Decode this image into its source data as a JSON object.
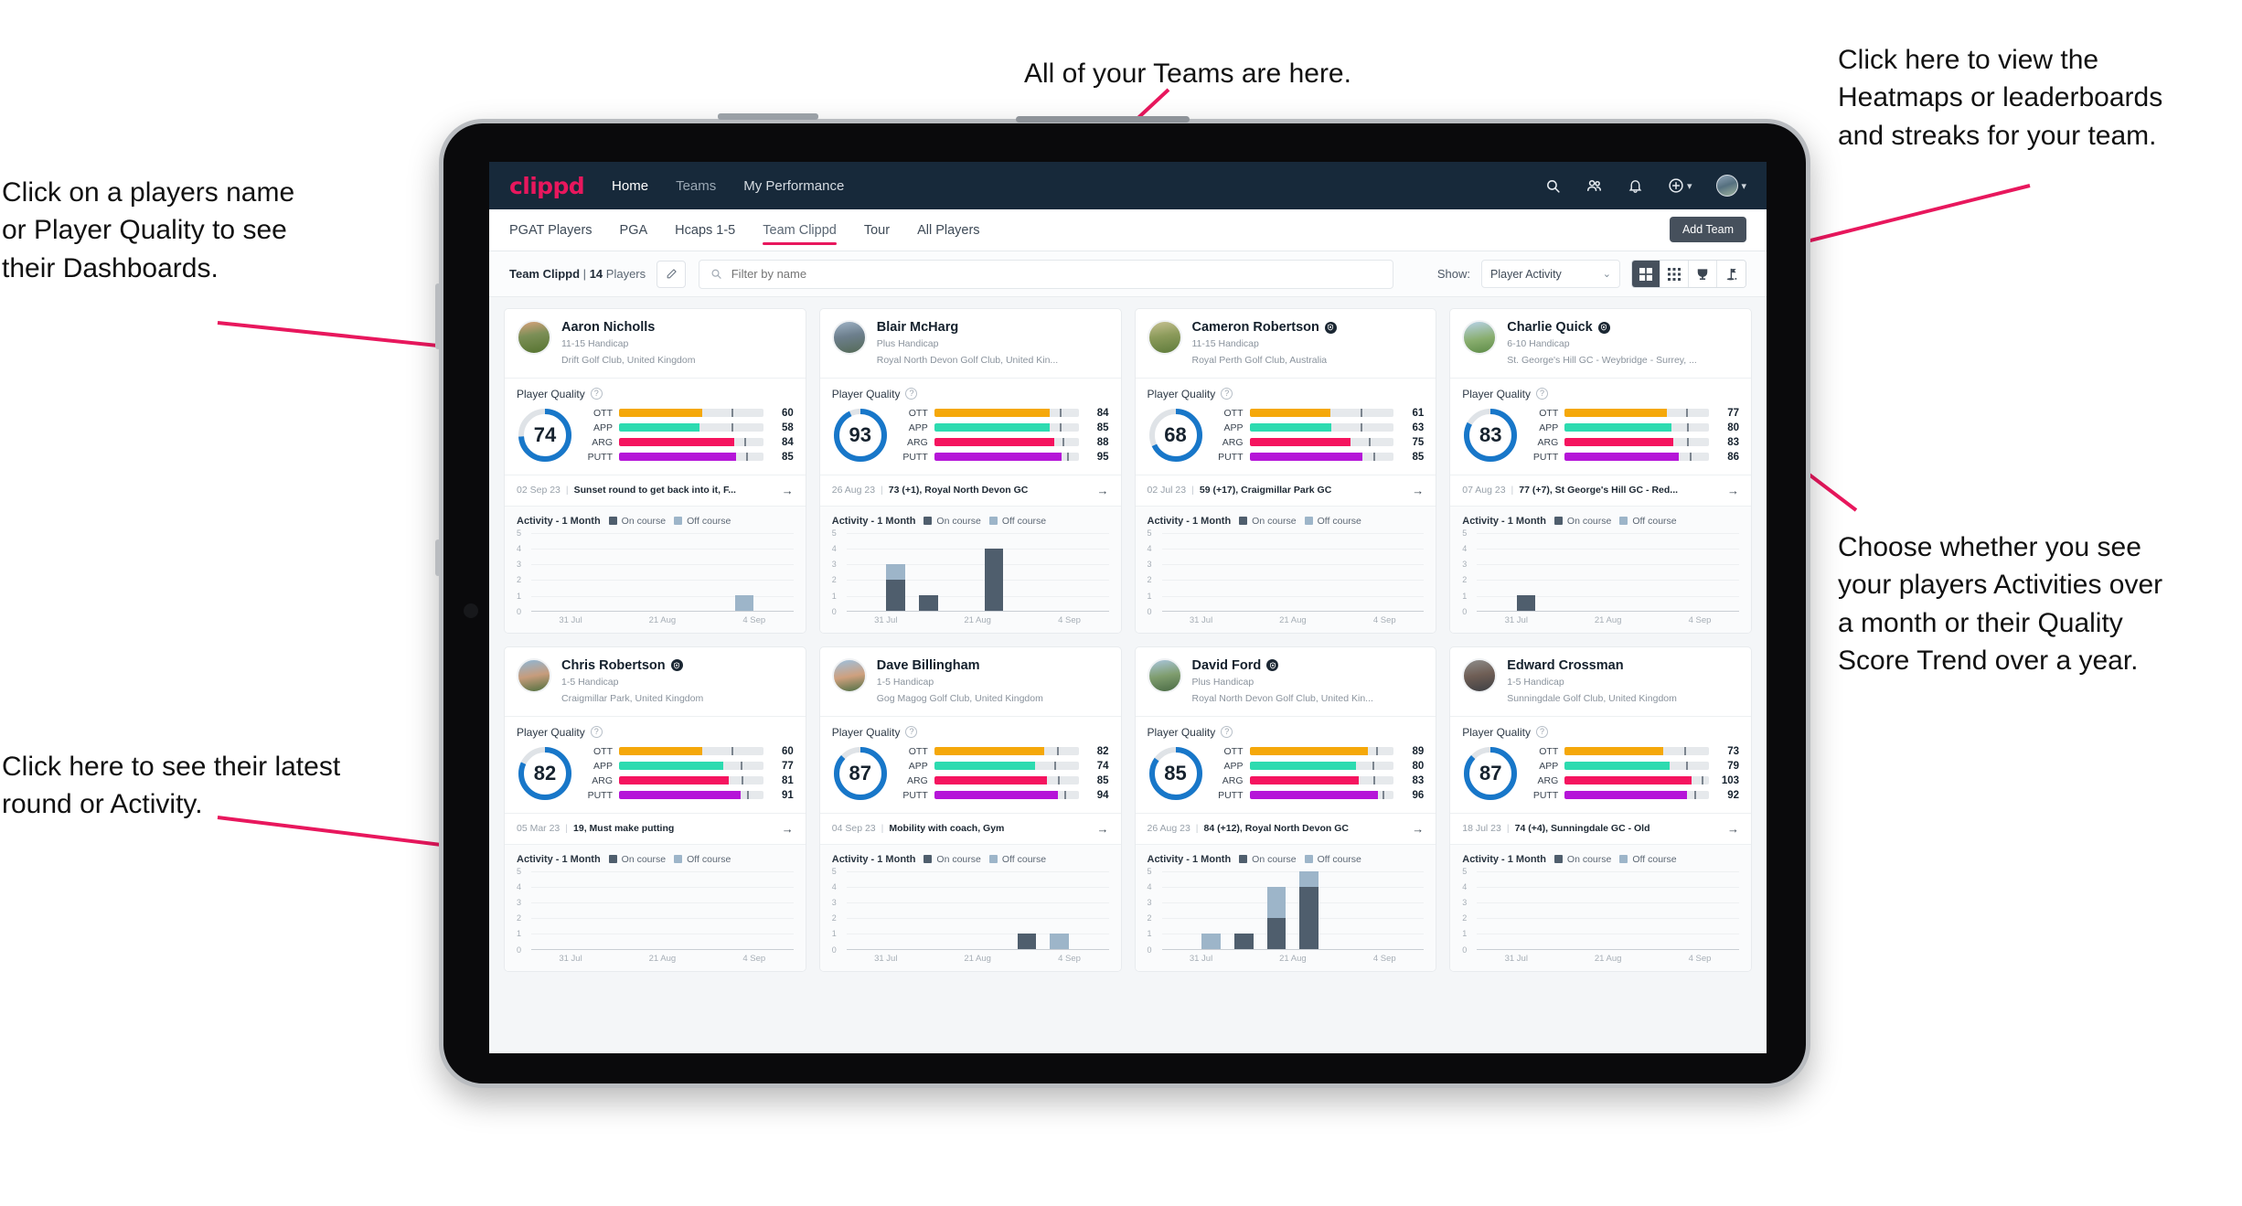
{
  "annotations": {
    "top_left": "Click on a players name\nor Player Quality to see\ntheir Dashboards.",
    "top_center": "All of your Teams are here.",
    "top_right": "Click here to view the\nHeatmaps or leaderboards\nand streaks for your team.",
    "right_bottom": "Choose whether you see\nyour players Activities over\na month or their Quality\nScore Trend over a year.",
    "bottom_left": "Click here to see their latest\nround or Activity.",
    "arrow_color": "#e8175d"
  },
  "app": {
    "logo": "clippd",
    "nav": [
      {
        "label": "Home",
        "active": true
      },
      {
        "label": "Teams",
        "active": false
      },
      {
        "label": "My Performance",
        "active": false
      }
    ],
    "header_icons": [
      {
        "name": "search-icon"
      },
      {
        "name": "people-icon"
      },
      {
        "name": "bell-icon"
      },
      {
        "name": "plus-circle-icon"
      },
      {
        "name": "avatar-icon"
      }
    ]
  },
  "tabs": [
    {
      "label": "PGAT Players",
      "active": false
    },
    {
      "label": "PGA",
      "active": false
    },
    {
      "label": "Hcaps 1-5",
      "active": false
    },
    {
      "label": "Team Clippd",
      "active": true
    },
    {
      "label": "Tour",
      "active": false
    },
    {
      "label": "All Players",
      "active": false
    }
  ],
  "add_team_label": "Add Team",
  "filterbar": {
    "team_name": "Team Clippd",
    "separator": "|",
    "player_count": "14",
    "players_word": "Players",
    "edit_icon": "pencil-icon",
    "search_placeholder": "Filter by name",
    "search_value": "",
    "show_label": "Show:",
    "show_value": "Player Activity",
    "show_options": [
      "Player Activity",
      "Quality Score Trend"
    ],
    "views": [
      {
        "name": "grid-large-view",
        "active": true
      },
      {
        "name": "heatmap-grid-view",
        "active": false
      },
      {
        "name": "trophy-leaderboard-view",
        "active": false
      },
      {
        "name": "golf-flag-streaks-view",
        "active": false
      }
    ]
  },
  "card_labels": {
    "quality_title": "Player Quality",
    "help_glyph": "?",
    "activity_title": "Activity - 1 Month",
    "legend_on": "On course",
    "legend_off": "Off course",
    "arrow_glyph": "→",
    "y_ticks": [
      "5",
      "4",
      "3",
      "2",
      "1",
      "0"
    ],
    "x_ticks": [
      "31 Jul",
      "21 Aug",
      "4 Sep"
    ]
  },
  "skill_colors": {
    "OTT": "#f5a80a",
    "APP": "#2ddbb0",
    "ARG": "#f5145f",
    "PUTT": "#b515d8",
    "donut": "#1877c9",
    "donut_track": "#dfe3e7"
  },
  "players": [
    {
      "name": "Aaron Nicholls",
      "verified": false,
      "handicap": "11-15 Handicap",
      "club": "Drift Golf Club, United Kingdom",
      "quality": 74,
      "skills": [
        {
          "label": "OTT",
          "value": 60,
          "fill": 58,
          "tick": 78
        },
        {
          "label": "APP",
          "value": 58,
          "fill": 56,
          "tick": 78
        },
        {
          "label": "ARG",
          "value": 84,
          "fill": 80,
          "tick": 87
        },
        {
          "label": "PUTT",
          "value": 85,
          "fill": 81,
          "tick": 88
        }
      ],
      "latest_date": "02 Sep 23",
      "latest_text": "Sunset round to get back into it, F...",
      "activity": [
        {
          "on": 0,
          "off": 0
        },
        {
          "on": 0,
          "off": 0
        },
        {
          "on": 0,
          "off": 0
        },
        {
          "on": 0,
          "off": 0
        },
        {
          "on": 0,
          "off": 0
        },
        {
          "on": 0,
          "off": 0
        },
        {
          "on": 0,
          "off": 1
        },
        {
          "on": 0,
          "off": 0
        }
      ]
    },
    {
      "name": "Blair McHarg",
      "verified": false,
      "handicap": "Plus Handicap",
      "club": "Royal North Devon Golf Club, United Kin...",
      "quality": 93,
      "skills": [
        {
          "label": "OTT",
          "value": 84,
          "fill": 80,
          "tick": 87
        },
        {
          "label": "APP",
          "value": 85,
          "fill": 80,
          "tick": 87
        },
        {
          "label": "ARG",
          "value": 88,
          "fill": 83,
          "tick": 89
        },
        {
          "label": "PUTT",
          "value": 95,
          "fill": 88,
          "tick": 92
        }
      ],
      "latest_date": "26 Aug 23",
      "latest_text": "73 (+1), Royal North Devon GC",
      "activity": [
        {
          "on": 0,
          "off": 0
        },
        {
          "on": 2,
          "off": 1
        },
        {
          "on": 1,
          "off": 0
        },
        {
          "on": 0,
          "off": 0
        },
        {
          "on": 4,
          "off": 0
        },
        {
          "on": 0,
          "off": 0
        },
        {
          "on": 0,
          "off": 0
        },
        {
          "on": 0,
          "off": 0
        }
      ]
    },
    {
      "name": "Cameron Robertson",
      "verified": true,
      "handicap": "11-15 Handicap",
      "club": "Royal Perth Golf Club, Australia",
      "quality": 68,
      "skills": [
        {
          "label": "OTT",
          "value": 61,
          "fill": 56,
          "tick": 77
        },
        {
          "label": "APP",
          "value": 63,
          "fill": 57,
          "tick": 77
        },
        {
          "label": "ARG",
          "value": 75,
          "fill": 70,
          "tick": 83
        },
        {
          "label": "PUTT",
          "value": 85,
          "fill": 78,
          "tick": 86
        }
      ],
      "latest_date": "02 Jul 23",
      "latest_text": "59 (+17), Craigmillar Park GC",
      "activity": [
        {
          "on": 0,
          "off": 0
        },
        {
          "on": 0,
          "off": 0
        },
        {
          "on": 0,
          "off": 0
        },
        {
          "on": 0,
          "off": 0
        },
        {
          "on": 0,
          "off": 0
        },
        {
          "on": 0,
          "off": 0
        },
        {
          "on": 0,
          "off": 0
        },
        {
          "on": 0,
          "off": 0
        }
      ]
    },
    {
      "name": "Charlie Quick",
      "verified": true,
      "handicap": "6-10 Handicap",
      "club": "St. George's Hill GC - Weybridge - Surrey, ...",
      "quality": 83,
      "skills": [
        {
          "label": "OTT",
          "value": 77,
          "fill": 71,
          "tick": 84
        },
        {
          "label": "APP",
          "value": 80,
          "fill": 74,
          "tick": 85
        },
        {
          "label": "ARG",
          "value": 83,
          "fill": 75,
          "tick": 85
        },
        {
          "label": "PUTT",
          "value": 86,
          "fill": 79,
          "tick": 87
        }
      ],
      "latest_date": "07 Aug 23",
      "latest_text": "77 (+7), St George's Hill GC - Red...",
      "activity": [
        {
          "on": 0,
          "off": 0
        },
        {
          "on": 1,
          "off": 0
        },
        {
          "on": 0,
          "off": 0
        },
        {
          "on": 0,
          "off": 0
        },
        {
          "on": 0,
          "off": 0
        },
        {
          "on": 0,
          "off": 0
        },
        {
          "on": 0,
          "off": 0
        },
        {
          "on": 0,
          "off": 0
        }
      ]
    },
    {
      "name": "Chris Robertson",
      "verified": true,
      "handicap": "1-5 Handicap",
      "club": "Craigmillar Park, United Kingdom",
      "quality": 82,
      "skills": [
        {
          "label": "OTT",
          "value": 60,
          "fill": 58,
          "tick": 78
        },
        {
          "label": "APP",
          "value": 77,
          "fill": 72,
          "tick": 84
        },
        {
          "label": "ARG",
          "value": 81,
          "fill": 76,
          "tick": 85
        },
        {
          "label": "PUTT",
          "value": 91,
          "fill": 84,
          "tick": 89
        }
      ],
      "latest_date": "05 Mar 23",
      "latest_text": "19, Must make putting",
      "activity": [
        {
          "on": 0,
          "off": 0
        },
        {
          "on": 0,
          "off": 0
        },
        {
          "on": 0,
          "off": 0
        },
        {
          "on": 0,
          "off": 0
        },
        {
          "on": 0,
          "off": 0
        },
        {
          "on": 0,
          "off": 0
        },
        {
          "on": 0,
          "off": 0
        },
        {
          "on": 0,
          "off": 0
        }
      ]
    },
    {
      "name": "Dave Billingham",
      "verified": false,
      "handicap": "1-5 Handicap",
      "club": "Gog Magog Golf Club, United Kingdom",
      "quality": 87,
      "skills": [
        {
          "label": "OTT",
          "value": 82,
          "fill": 76,
          "tick": 85
        },
        {
          "label": "APP",
          "value": 74,
          "fill": 70,
          "tick": 83
        },
        {
          "label": "ARG",
          "value": 85,
          "fill": 78,
          "tick": 86
        },
        {
          "label": "PUTT",
          "value": 94,
          "fill": 86,
          "tick": 90
        }
      ],
      "latest_date": "04 Sep 23",
      "latest_text": "Mobility with coach, Gym",
      "activity": [
        {
          "on": 0,
          "off": 0
        },
        {
          "on": 0,
          "off": 0
        },
        {
          "on": 0,
          "off": 0
        },
        {
          "on": 0,
          "off": 0
        },
        {
          "on": 0,
          "off": 0
        },
        {
          "on": 1,
          "off": 0
        },
        {
          "on": 0,
          "off": 1
        },
        {
          "on": 0,
          "off": 0
        }
      ]
    },
    {
      "name": "David Ford",
      "verified": true,
      "handicap": "Plus Handicap",
      "club": "Royal North Devon Golf Club, United Kin...",
      "quality": 85,
      "skills": [
        {
          "label": "OTT",
          "value": 89,
          "fill": 82,
          "tick": 88
        },
        {
          "label": "APP",
          "value": 80,
          "fill": 74,
          "tick": 85
        },
        {
          "label": "ARG",
          "value": 83,
          "fill": 76,
          "tick": 86
        },
        {
          "label": "PUTT",
          "value": 96,
          "fill": 89,
          "tick": 92
        }
      ],
      "latest_date": "26 Aug 23",
      "latest_text": "84 (+12), Royal North Devon GC",
      "activity": [
        {
          "on": 0,
          "off": 0
        },
        {
          "on": 0,
          "off": 1
        },
        {
          "on": 1,
          "off": 0
        },
        {
          "on": 2,
          "off": 2
        },
        {
          "on": 4,
          "off": 1
        },
        {
          "on": 0,
          "off": 0
        },
        {
          "on": 0,
          "off": 0
        },
        {
          "on": 0,
          "off": 0
        }
      ]
    },
    {
      "name": "Edward Crossman",
      "verified": false,
      "handicap": "1-5 Handicap",
      "club": "Sunningdale Golf Club, United Kingdom",
      "quality": 87,
      "skills": [
        {
          "label": "OTT",
          "value": 73,
          "fill": 68,
          "tick": 83
        },
        {
          "label": "APP",
          "value": 79,
          "fill": 73,
          "tick": 84
        },
        {
          "label": "ARG",
          "value": 103,
          "fill": 88,
          "tick": 95
        },
        {
          "label": "PUTT",
          "value": 92,
          "fill": 85,
          "tick": 90
        }
      ],
      "latest_date": "18 Jul 23",
      "latest_text": "74 (+4), Sunningdale GC - Old",
      "activity": [
        {
          "on": 0,
          "off": 0
        },
        {
          "on": 0,
          "off": 0
        },
        {
          "on": 0,
          "off": 0
        },
        {
          "on": 0,
          "off": 0
        },
        {
          "on": 0,
          "off": 0
        },
        {
          "on": 0,
          "off": 0
        },
        {
          "on": 0,
          "off": 0
        },
        {
          "on": 0,
          "off": 0
        }
      ]
    }
  ]
}
